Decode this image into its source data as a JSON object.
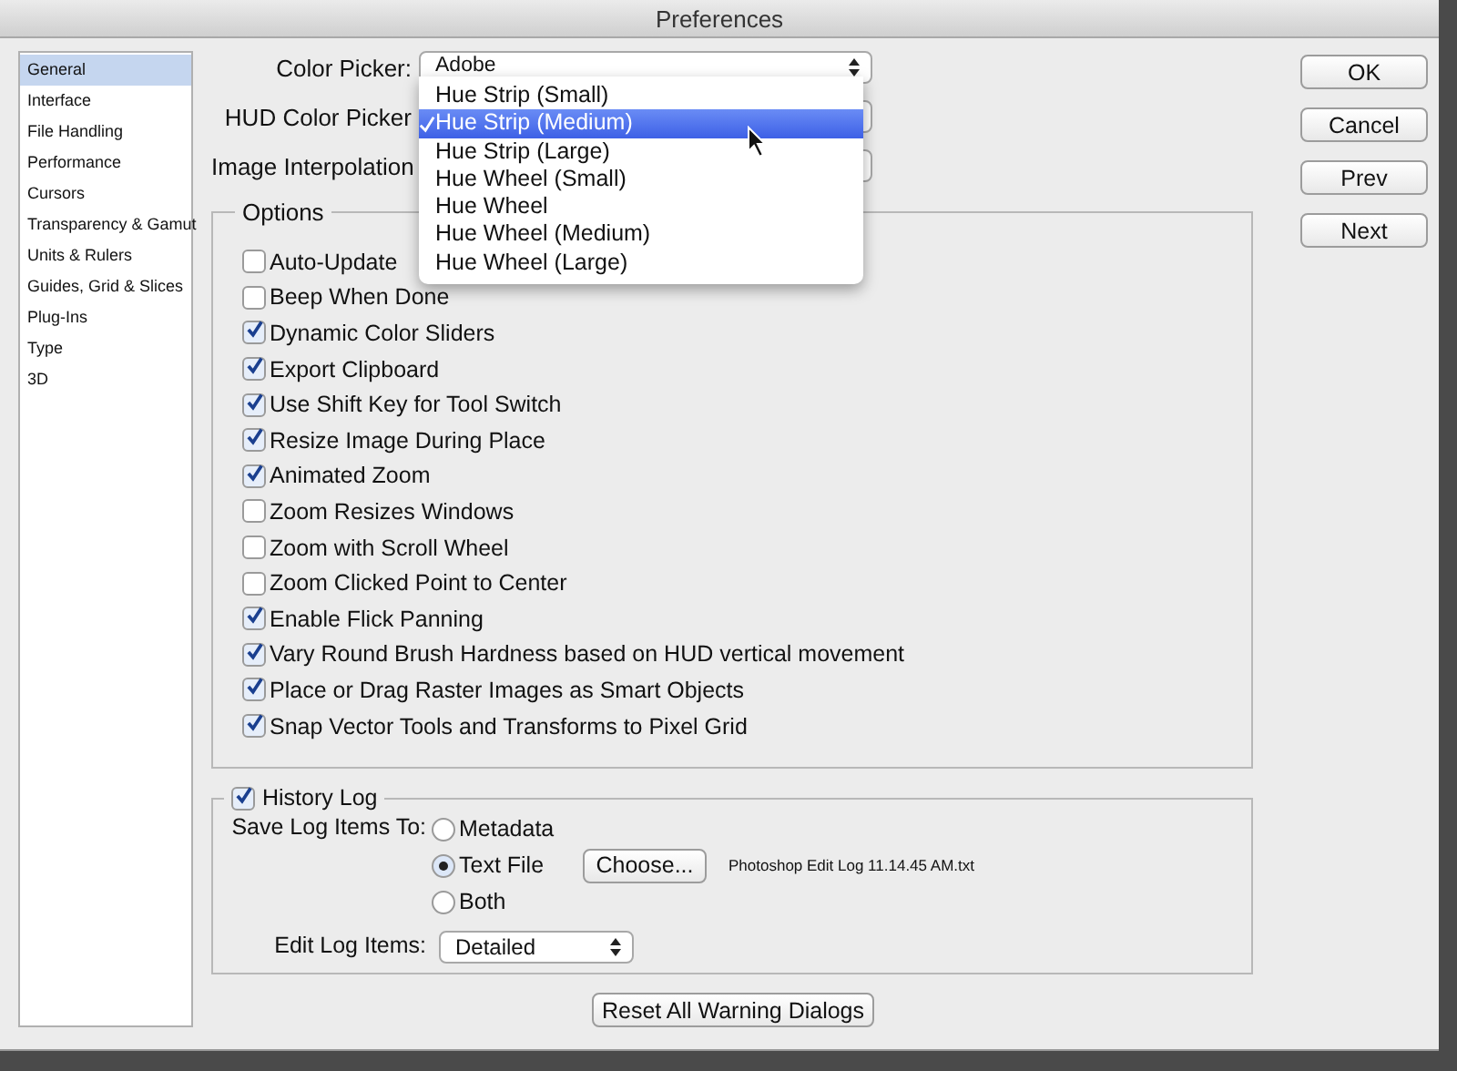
{
  "window": {
    "title": "Preferences"
  },
  "sidebar": {
    "items": [
      {
        "label": "General",
        "selected": true
      },
      {
        "label": "Interface",
        "selected": false
      },
      {
        "label": "File Handling",
        "selected": false
      },
      {
        "label": "Performance",
        "selected": false
      },
      {
        "label": "Cursors",
        "selected": false
      },
      {
        "label": "Transparency & Gamut",
        "selected": false
      },
      {
        "label": "Units & Rulers",
        "selected": false
      },
      {
        "label": "Guides, Grid & Slices",
        "selected": false
      },
      {
        "label": "Plug-Ins",
        "selected": false
      },
      {
        "label": "Type",
        "selected": false
      },
      {
        "label": "3D",
        "selected": false
      }
    ]
  },
  "fields": [
    {
      "label": "Color Picker:",
      "value": "Adobe"
    },
    {
      "label": "HUD Color Picker"
    },
    {
      "label": "Image Interpolation"
    }
  ],
  "popup": {
    "items": [
      {
        "label": "Hue Strip (Small)",
        "selected": false
      },
      {
        "label": "Hue Strip (Medium)",
        "selected": true
      },
      {
        "label": "Hue Strip (Large)",
        "selected": false
      },
      {
        "label": "Hue Wheel (Small)",
        "selected": false
      },
      {
        "label": "Hue Wheel",
        "selected": false
      },
      {
        "label": "Hue Wheel (Medium)",
        "selected": false
      },
      {
        "label": "Hue Wheel (Large)",
        "selected": false
      }
    ]
  },
  "options": {
    "title": "Options",
    "items": [
      {
        "label": "Auto-Update",
        "checked": false
      },
      {
        "label": "Beep When Done",
        "checked": false
      },
      {
        "label": "Dynamic Color Sliders",
        "checked": true
      },
      {
        "label": "Export Clipboard",
        "checked": true
      },
      {
        "label": "Use Shift Key for Tool Switch",
        "checked": true
      },
      {
        "label": "Resize Image During Place",
        "checked": true
      },
      {
        "label": "Animated Zoom",
        "checked": true
      },
      {
        "label": "Zoom Resizes Windows",
        "checked": false
      },
      {
        "label": "Zoom with Scroll Wheel",
        "checked": false
      },
      {
        "label": "Zoom Clicked Point to Center",
        "checked": false
      },
      {
        "label": "Enable Flick Panning",
        "checked": true
      },
      {
        "label": "Vary Round Brush Hardness based on HUD vertical movement",
        "checked": true
      },
      {
        "label": "Place or Drag Raster Images as Smart Objects",
        "checked": true
      },
      {
        "label": "Snap Vector Tools and Transforms to Pixel Grid",
        "checked": true
      }
    ]
  },
  "history_log": {
    "label": "History Log",
    "checked": true,
    "save_label": "Save Log Items To:",
    "radios": [
      {
        "label": "Metadata",
        "selected": false
      },
      {
        "label": "Text File",
        "selected": true
      },
      {
        "label": "Both",
        "selected": false
      }
    ],
    "choose_button": "Choose...",
    "file_name": "Photoshop Edit Log 11.14.45 AM.txt",
    "edit_label": "Edit Log Items:",
    "edit_value": "Detailed"
  },
  "reset_button": "Reset All Warning Dialogs",
  "buttons": [
    "OK",
    "Cancel",
    "Prev",
    "Next"
  ]
}
